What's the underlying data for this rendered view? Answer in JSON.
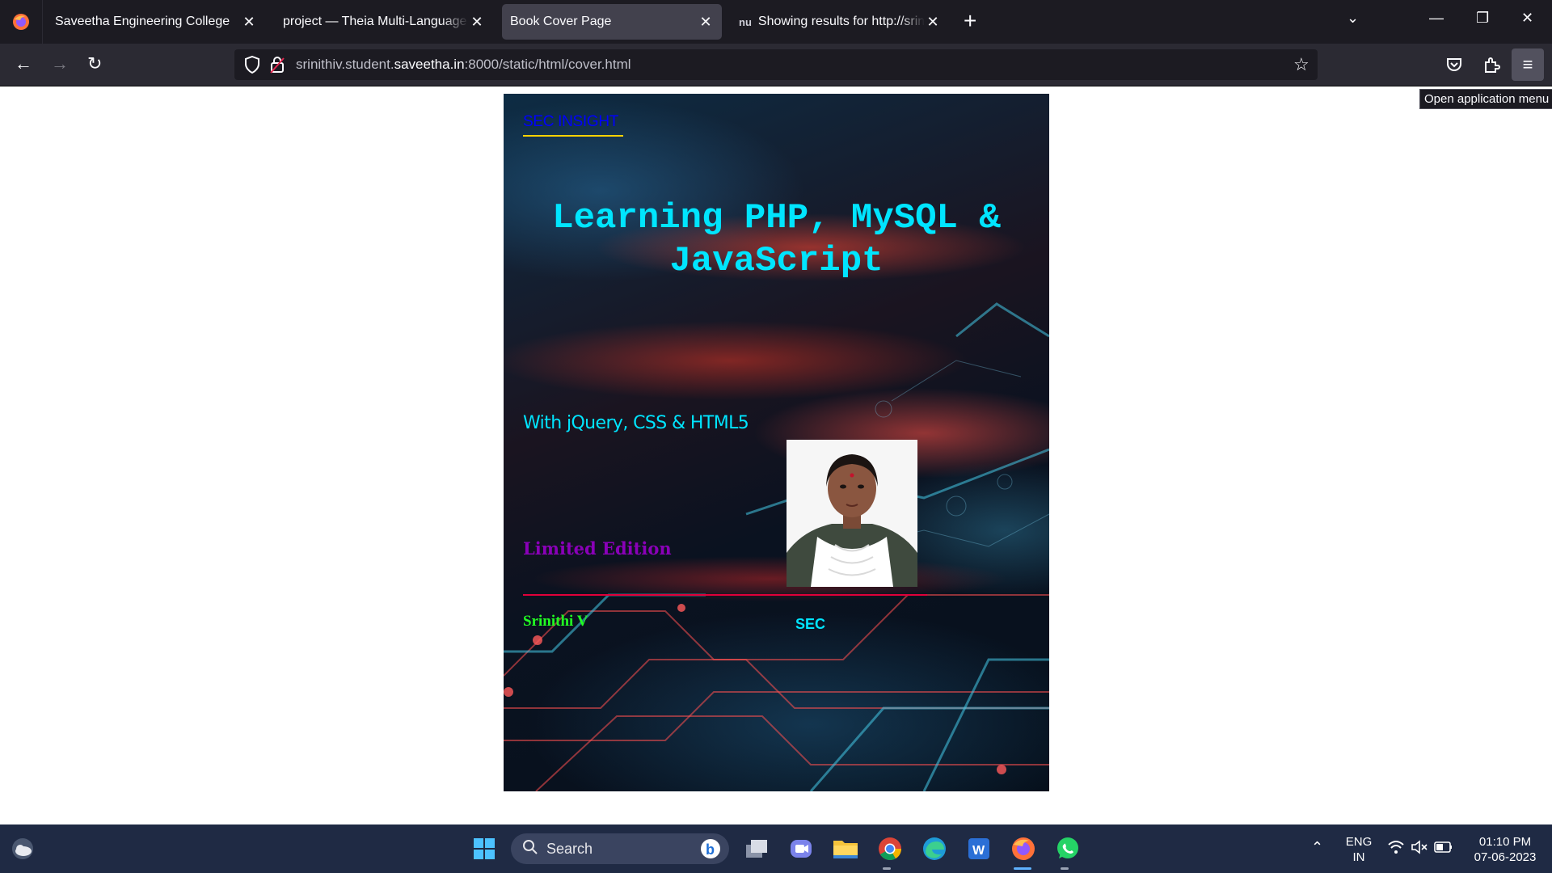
{
  "browser": {
    "tabs": [
      {
        "label": "Saveetha Engineering College",
        "active": false
      },
      {
        "label": "project — Theia Multi-Language Ex",
        "active": false
      },
      {
        "label": "Book Cover Page",
        "active": true
      },
      {
        "label": "Showing results for http://srinith",
        "active": false,
        "favicon": "nu"
      }
    ],
    "url_prefix": "srinithiv.student.",
    "url_domain": "saveetha.in",
    "url_suffix": ":8000/static/html/cover.html",
    "tooltip": "Open application menu"
  },
  "cover": {
    "brand": "SEC INSIGHT",
    "title_line1": "Learning PHP, MySQL &",
    "title_line2": "JavaScript",
    "subtitle": "With jQuery, CSS & HTML5",
    "edition": "Limited Edition",
    "author": "Srinithi V",
    "publisher": "SEC"
  },
  "taskbar": {
    "search_label": "Search",
    "lang_line1": "ENG",
    "lang_line2": "IN",
    "time": "01:10 PM",
    "date": "07-06-2023"
  },
  "colors": {
    "accent_cyan": "#00e5ff",
    "brand_blue": "#0000ff",
    "edition_purple": "#8a00b8",
    "author_green": "#22ff22",
    "rule_red": "#e0003a"
  }
}
